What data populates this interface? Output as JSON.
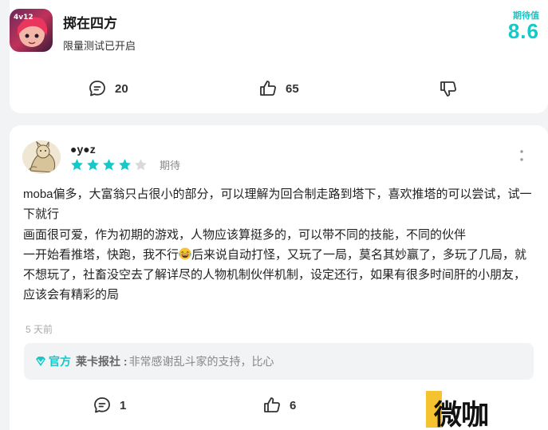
{
  "app": {
    "title": "掷在四方",
    "subtitle": "限量测试已开启",
    "score_label": "期待值",
    "score_value": "8.6",
    "icon_text": "4v12"
  },
  "top_actions": {
    "comment_count": "20",
    "like_count": "65"
  },
  "review": {
    "username": "●y●z",
    "rating": 4,
    "rating_max": 5,
    "rating_tag": "期待",
    "lines": [
      "moba偏多，大富翁只占很小的部分，可以理解为回合制走路到塔下，喜欢推塔的可以尝试，试一下就行",
      "画面很可爱，作为初期的游戏，人物应该算挺多的，可以带不同的技能，不同的伙伴",
      "一开始看推塔，快跑，我不行",
      "后来说自动打怪，又玩了一局，莫名其妙赢了，多玩了几局，就不想玩了，社畜没空去了解详尽的人物机制伙伴机制，设定还行，如果有很多时间肝的小朋友，应该会有精彩的局"
    ],
    "time": "5 天前",
    "reply": {
      "official_label": "官方",
      "replier": "莱卡报社 :",
      "text": "非常感谢乱斗家的支持，比心"
    },
    "comment_count": "1",
    "like_count": "6"
  },
  "watermark": "微咖",
  "colors": {
    "accent": "#14c9c9",
    "star_empty": "#d9d9d9",
    "watermark_yellow": "#f5c330"
  },
  "icons": {
    "comment": "comment-bubble-icon",
    "like": "thumbs-up-icon",
    "dislike": "thumbs-down-icon",
    "more": "more-vertical-icon",
    "official": "official-badge-icon",
    "emoji": "laughing-emoji-icon"
  }
}
